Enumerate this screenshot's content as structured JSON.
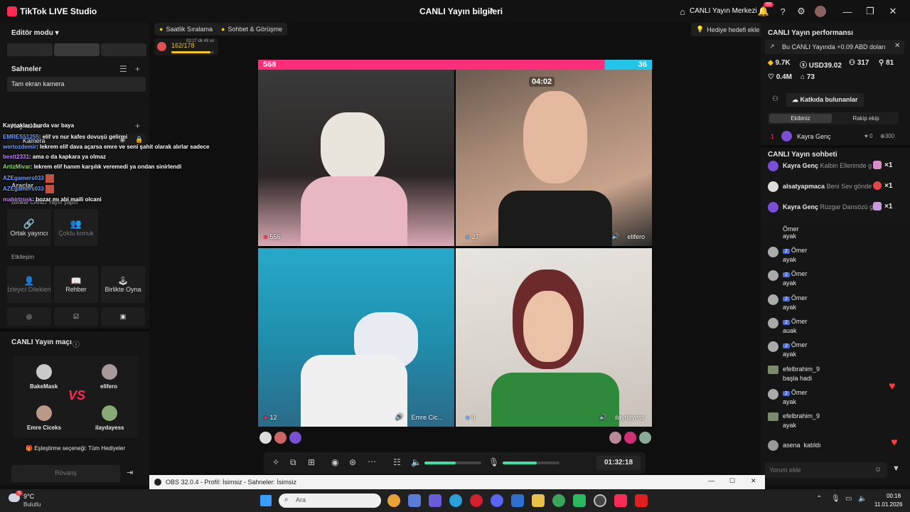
{
  "titlebar": {
    "app_name": "TikTok LIVE Studio",
    "center_title": "CANLI Yayın bilgileri",
    "center_right": "CANLI Yayın Merkezi",
    "notif_count": "89"
  },
  "left": {
    "editor_mode": "Editör modu",
    "scenes_title": "Sahneler",
    "scene_item": "Tam ekran kamera",
    "sources_title": "Kaynaklar",
    "camera_label": "Kamera",
    "tools_title": "Araçlar",
    "multiguest": "Birlikte CANLI Yayın yapın",
    "cohost": "Ortak yayıncı",
    "multi_guest": "Çoklu konuk",
    "interaction": "Etkileşim",
    "viewer_requests": "İzleyici Dilekleri",
    "guide": "Rehber",
    "play_together": "Birlikte Oyna"
  },
  "overlay_chat": [
    {
      "user": "",
      "text": "Kaynaklar: burda var baya"
    },
    {
      "user": "EMRES51255",
      "text": ": elif vs nur kafes dovuşü gelirmi"
    },
    {
      "user": "wertozdemir",
      "text": ": lekrem elif dava açarsa emre ve seni şahit olarak alırlar sadece"
    },
    {
      "user": "bestt2331",
      "text": ": ama o da kapkara ya olmaz"
    },
    {
      "user": "ArtizMivar",
      "text": ": lekrem elif hanım karşılık veremedi ya ondan sinirlendi"
    },
    {
      "user": "AZEgamers033",
      "text": ""
    },
    {
      "user": "AZEgamers033",
      "text": ""
    },
    {
      "user": "mahirtrnsk",
      "text": ": bozar mı abi maili olcani"
    }
  ],
  "match": {
    "title": "CANLI Yayın maçı",
    "p1": "BakeMask",
    "p2": "elifero",
    "p3": "Emre Ciceks",
    "p4": "ilaydayess",
    "vs": "VS",
    "match_option": "Eşleştirme seçeneği: Tüm Hediyeler",
    "rematch": "Rövanş"
  },
  "center": {
    "hourly_rank": "Saatlik Sıralama",
    "chat_meet": "Sohbet & Görüşme",
    "gift_goal": "Hediye hedefi ekle",
    "goal_progress": "162/178",
    "goal_timer": "03:27 dk 49 sn",
    "score_left": "568",
    "score_right": "36",
    "battle_timer": "04:02",
    "tile1_count": "556",
    "tile2_count": "27",
    "tile2_name": "elifero",
    "tile3_count": "12",
    "tile3_name": "Emre Cic...",
    "tile4_count": "9",
    "tile4_name": "ilaydayess",
    "stream_time": "01:32:18",
    "volume_level": 0.55,
    "mic_level": 0.6
  },
  "right": {
    "perf_title": "CANLI Yayın performansı",
    "perf_banner": "Bu CANLI Yayında +0.09 ABD doları",
    "stat1": "9.7K",
    "stat2": "USD39.02",
    "stat3": "317",
    "stat4": "81",
    "stat5": "0.4M",
    "stat6": "73",
    "contributors": "Katkıda bulunanlar",
    "tab_team": "Ekibiniz",
    "tab_rival": "Rakip ekip",
    "rank1_pos": "1",
    "rank1_name": "Kayra Genç",
    "rank1_a": "0",
    "rank1_b": "300",
    "chat_title": "CANLI Yayın sohbeti",
    "gifts": [
      {
        "name": "Kayra Genç",
        "text": "Kalbin Ellerimde g",
        "mult": "×1"
      },
      {
        "name": "alsatyapmaca",
        "text": "Beni Sev gönde",
        "mult": "×1"
      },
      {
        "name": "Kayra Genç",
        "text": "Rüzgar Dansözü g",
        "mult": "×1"
      }
    ],
    "msgs": [
      {
        "lvl": "2",
        "name": "Ömer",
        "text": "ayak"
      },
      {
        "lvl": "2",
        "name": "Ömer",
        "text": "ayak"
      },
      {
        "lvl": "2",
        "name": "Ömer",
        "text": "ayak"
      },
      {
        "lvl": "2",
        "name": "Ömer",
        "text": "ayak"
      },
      {
        "lvl": "2",
        "name": "Ömer",
        "text": "auak"
      },
      {
        "lvl": "2",
        "name": "Ömer",
        "text": "ayak"
      },
      {
        "lvl": "",
        "name": "efelbrahim_9",
        "text": "başla hadi"
      },
      {
        "lvl": "2",
        "name": "Ömer",
        "text": "ayak"
      },
      {
        "lvl": "",
        "name": "efelbrahim_9",
        "text": "ayak"
      }
    ],
    "join_name": "asena",
    "join_text": "katıldı",
    "comment_placeholder": "Yorum ekle"
  },
  "obs": {
    "title": "OBS 32.0.4 - Profil: İsimsiz - Sahneler: İsimsiz"
  },
  "taskbar": {
    "weather_temp": "9°C",
    "weather_desc": "Bulutlu",
    "weather_badge": "5",
    "search": "Ara",
    "time": "00:18",
    "date": "11.01.2026"
  }
}
